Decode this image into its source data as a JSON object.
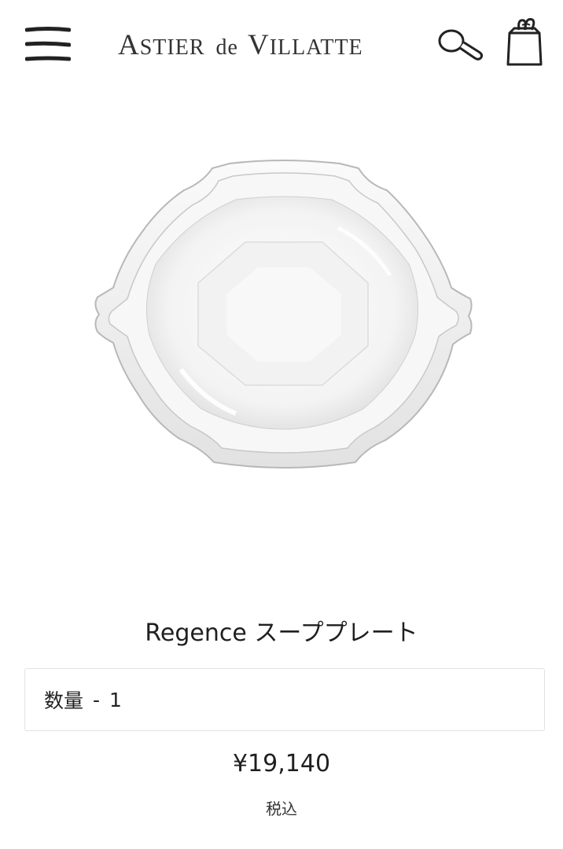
{
  "header": {
    "brand": {
      "astier_initial": "A",
      "astier_rest": "STIER",
      "de": "de",
      "villatte_initial": "V",
      "villatte_rest": "ILLATTE"
    },
    "menu_icon": "hamburger-menu-icon",
    "search_icon": "magnifier-icon",
    "cart_icon": "shopping-bag-icon"
  },
  "product": {
    "image": "white-octagonal-soup-plate",
    "title": "Regence スーププレート",
    "quantity_label": "数量",
    "quantity_separator": "-",
    "quantity_value": "1",
    "price": "¥19,140",
    "tax_note": "税込"
  }
}
